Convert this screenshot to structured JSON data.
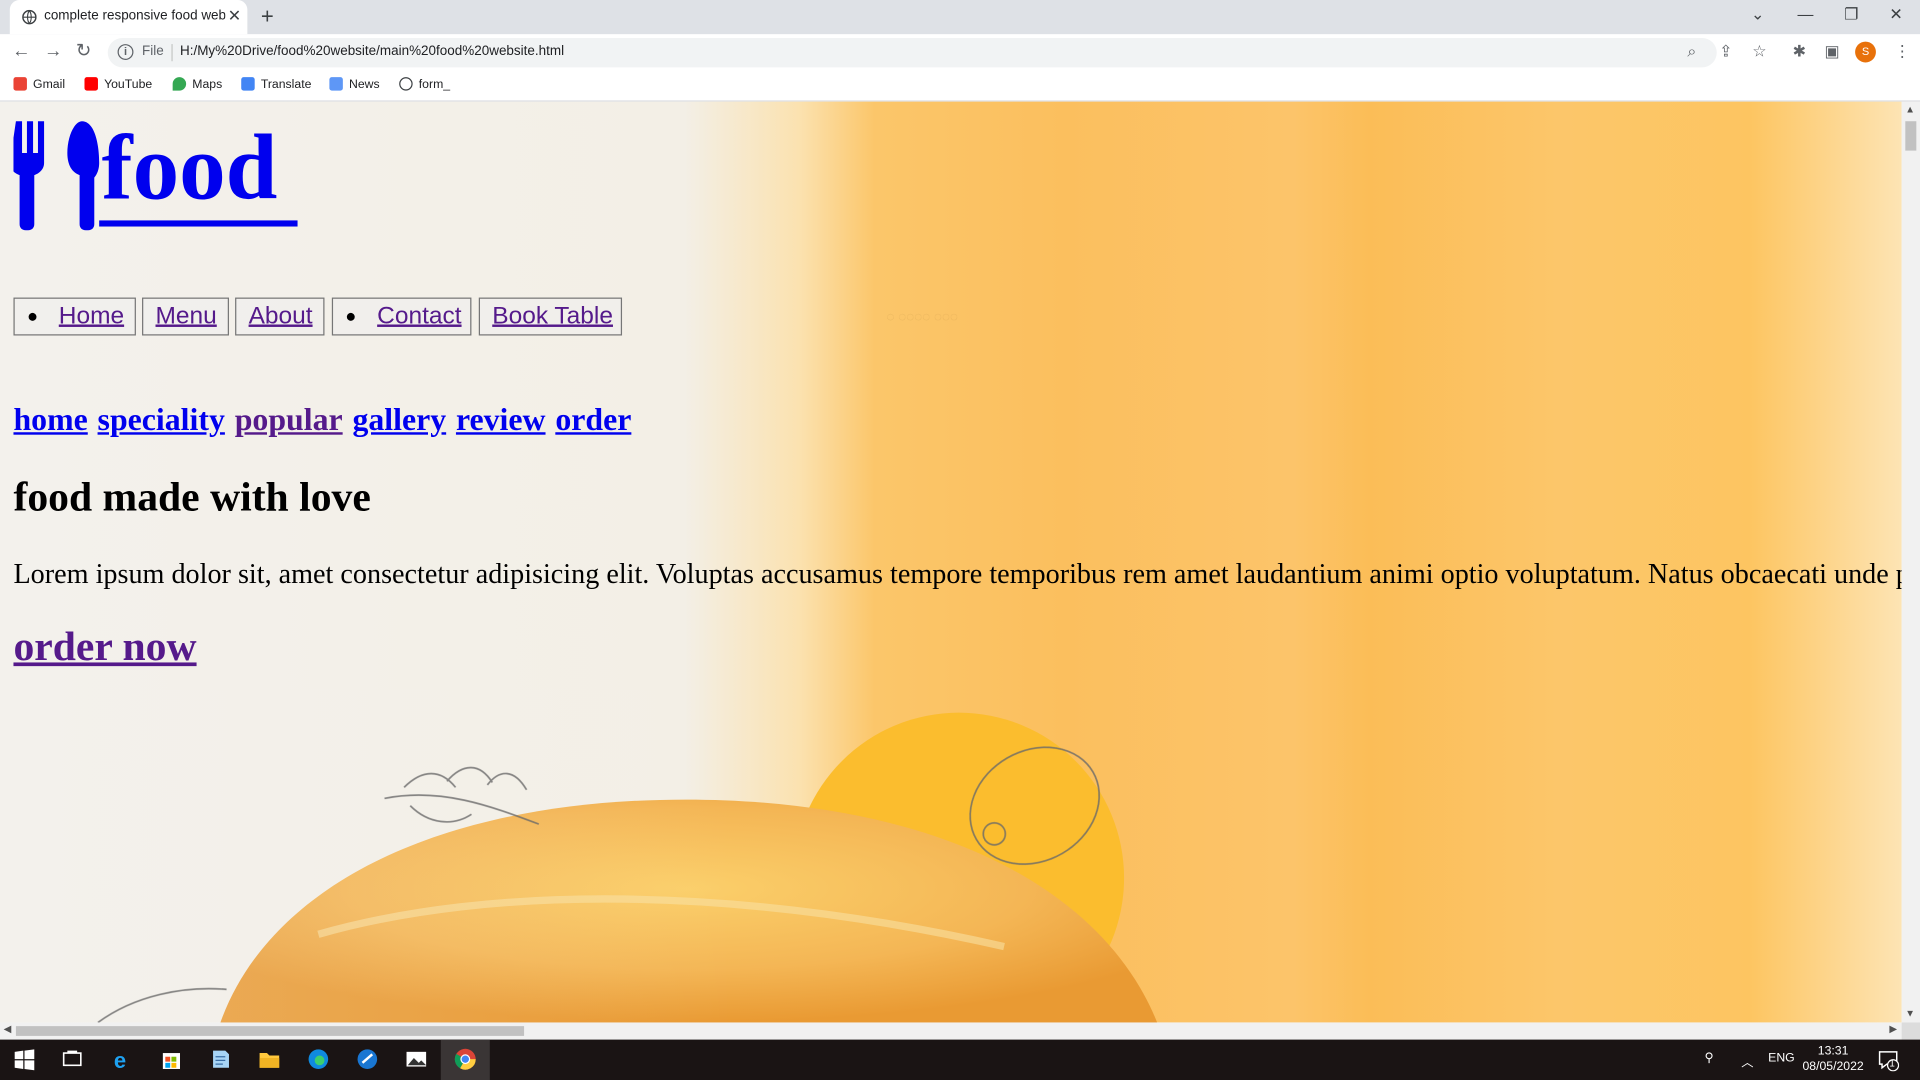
{
  "browser": {
    "tab_title": "complete responsive food website",
    "url": "H:/My%20Drive/food%20website/main%20food%20website.html",
    "scheme_label": "File",
    "bookmarks": [
      "Gmail",
      "YouTube",
      "Maps",
      "Translate",
      "News",
      "form_"
    ],
    "profile_initial": "S"
  },
  "page": {
    "logo_text": "food",
    "nav_buttons": [
      "Home",
      "Menu",
      "About",
      "Contact",
      "Book Table"
    ],
    "section_links": [
      "home",
      "speciality",
      "popular",
      "gallery",
      "review",
      "order"
    ],
    "heading": "food made with love",
    "paragraph": "Lorem ipsum dolor sit, amet consectetur adipisicing elit. Voluptas accusamus tempore temporibus rem amet laudantium animi optio voluptatum. Natus obcaecati unde perspiciatis",
    "cta": "order now"
  },
  "taskbar": {
    "language": "ENG",
    "time": "13:31",
    "date": "08/05/2022",
    "notifications": "1"
  },
  "colors": {
    "link": "#0000ee",
    "visited": "#551a8b",
    "accent_orange": "#fbbf5e",
    "avatar": "#e8710a"
  }
}
